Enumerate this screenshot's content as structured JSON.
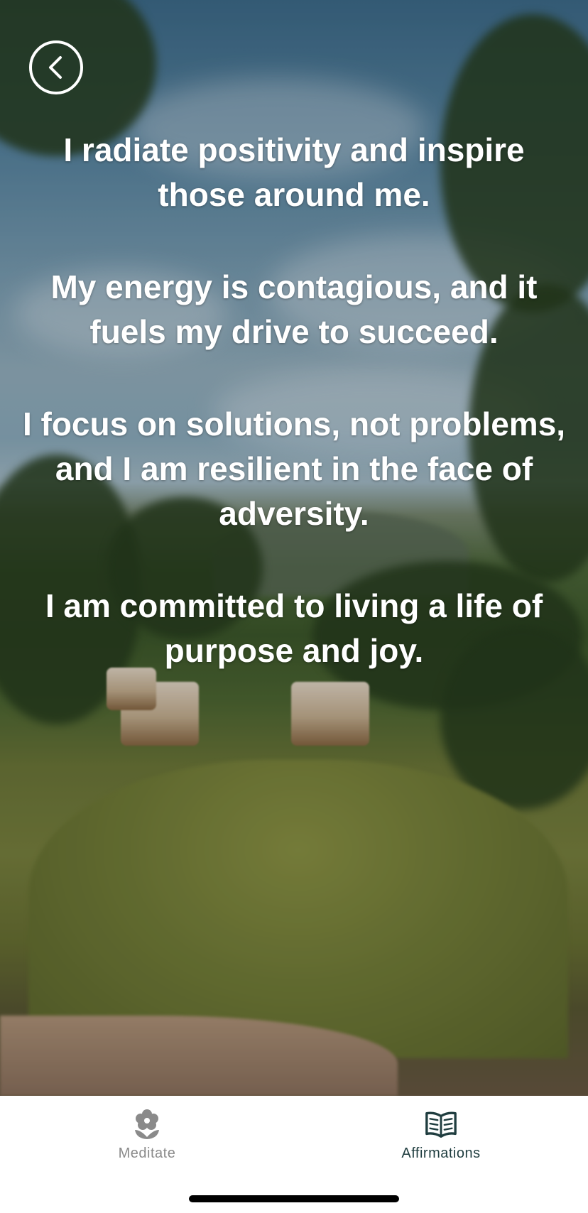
{
  "navigation": {
    "back_label": "Back"
  },
  "affirmations": [
    "I radiate positivity and inspire those around me.",
    "My energy is contagious, and it fuels my drive to succeed.",
    "I focus on solutions, not problems, and I am resilient in the face of adversity.",
    "I am committed to living a life of purpose and joy."
  ],
  "tab_bar": {
    "tabs": [
      {
        "label": "Meditate",
        "icon": "flower-icon",
        "active": false
      },
      {
        "label": "Affirmations",
        "icon": "open-book-icon",
        "active": true
      }
    ]
  },
  "colors": {
    "active_tab": "#1f3d3f",
    "inactive_tab": "#8a8a8a",
    "affirmation_text": "#ffffff"
  }
}
